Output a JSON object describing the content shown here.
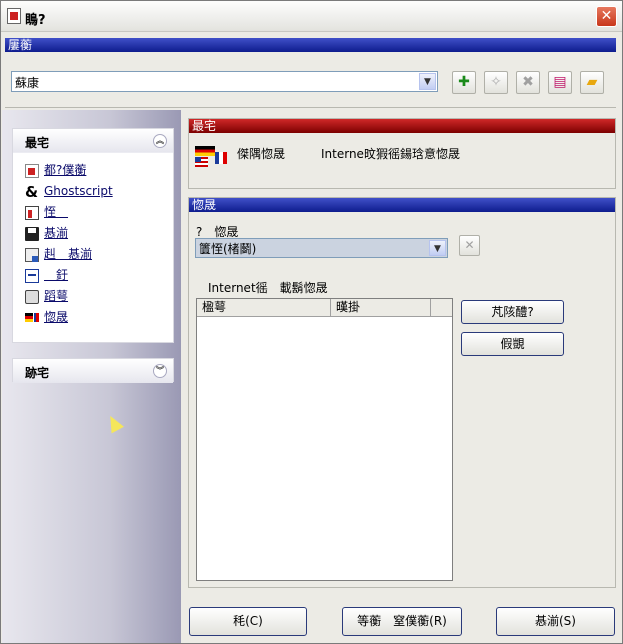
{
  "window": {
    "title": "瞗?"
  },
  "profile": {
    "header": "屢蘅",
    "selected": "蘇康"
  },
  "sidebar": {
    "pane1": {
      "title": "最宅",
      "items": [
        {
          "label": "都?僕蘅",
          "icon": "red-doc-icon"
        },
        {
          "label": "Ghostscript",
          "icon": "ghostscript-icon"
        },
        {
          "label": "恎　",
          "icon": "page-icon"
        },
        {
          "label": "惎湔",
          "icon": "save-icon"
        },
        {
          "label": "赳　惎湔",
          "icon": "network-save-icon"
        },
        {
          "label": "　釪",
          "icon": "settings-doc-icon"
        },
        {
          "label": "蹈萼",
          "icon": "printer-icon"
        },
        {
          "label": "惚晟",
          "icon": "flags-icon"
        }
      ]
    },
    "pane2": {
      "title": "跡宅"
    }
  },
  "section1": {
    "header": "最宅",
    "col1": "傑隅惚晟",
    "col2": "Interne旼猳徭鍚琀意惚晟"
  },
  "section2": {
    "header": "惚晟",
    "lang_label": "?　惚晟",
    "lang_value": "籄恎(楮鬬)",
    "list_caption": "Internet徭　載鬍惚晟",
    "list_columns": [
      "楹萼",
      "暵掛"
    ],
    "add_button": "芃陔醴?",
    "delete_button": "假覬"
  },
  "footer": {
    "ok": "秏(C)",
    "save_profile": "等蘅　窒僕蘅(R)",
    "save": "惎湔(S)"
  }
}
